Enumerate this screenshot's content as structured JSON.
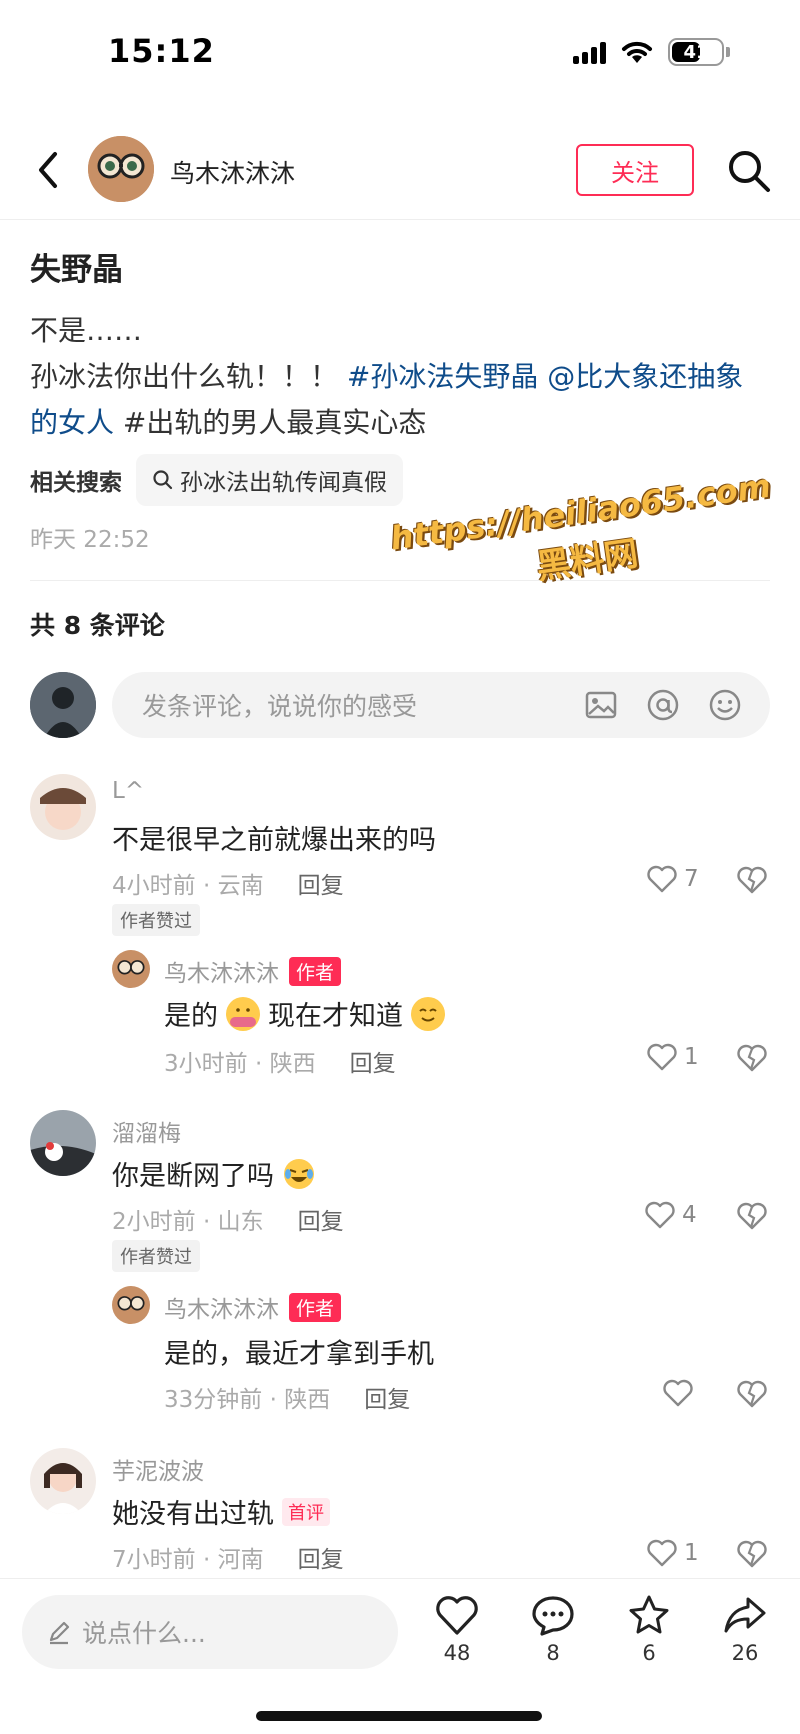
{
  "status": {
    "time": "15:12",
    "battery": "41"
  },
  "header": {
    "username": "鸟木沐沐沐",
    "follow_label": "关注"
  },
  "post": {
    "title": "失野晶",
    "line1": "不是……",
    "line2_plain": "孙冰法你出什么轨！！！",
    "tag1": "#孙冰法失野晶",
    "mention": "@比大象还抽象的女人",
    "tag2": "#出轨的男人最真实心态",
    "related_label": "相关搜索",
    "related_query": "孙冰法出轨传闻真假",
    "time": "昨天 22:52"
  },
  "watermark": {
    "url": "https://heiliao65.com",
    "name": "黑料网"
  },
  "comments_header": "共 8 条评论",
  "comment_input": {
    "placeholder": "发条评论，说说你的感受"
  },
  "comments": [
    {
      "name": "L^",
      "text": "不是很早之前就爆出来的吗",
      "time": "4小时前 · 云南",
      "reply": "回复",
      "likes": "7",
      "badge": "作者赞过"
    },
    {
      "name": "鸟木沐沐沐",
      "author_tag": "作者",
      "text_a": "是的",
      "text_b": "现在才知道",
      "time": "3小时前 · 陕西",
      "reply": "回复",
      "likes": "1"
    },
    {
      "name": "溜溜梅",
      "text": "你是断网了吗",
      "time": "2小时前 · 山东",
      "reply": "回复",
      "likes": "4",
      "badge": "作者赞过"
    },
    {
      "name": "鸟木沐沐沐",
      "author_tag": "作者",
      "text": "是的，最近才拿到手机",
      "time": "33分钟前 · 陕西",
      "reply": "回复",
      "likes": ""
    },
    {
      "name": "芋泥波波",
      "text": "她没有出过轨",
      "first_tag": "首评",
      "time": "7小时前 · 河南",
      "reply": "回复",
      "likes": "1"
    }
  ],
  "bottom": {
    "say_placeholder": "说点什么...",
    "likes": "48",
    "comments": "8",
    "favorites": "6",
    "shares": "26"
  },
  "colors": {
    "accent": "#fe2c55",
    "link": "#0f4c8a"
  }
}
